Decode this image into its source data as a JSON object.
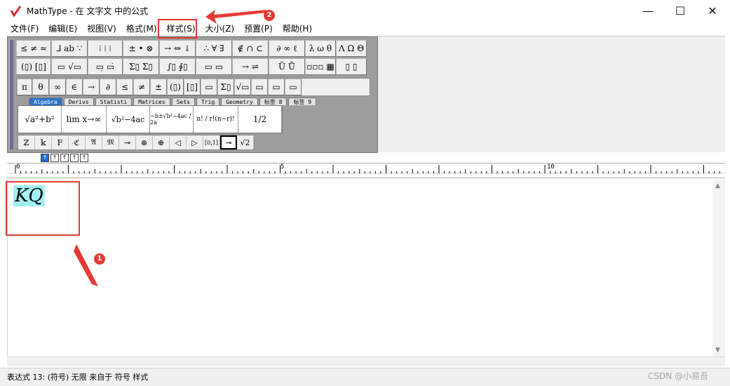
{
  "window": {
    "title": "MathType - 在 文字文 中的公式",
    "controls": {
      "minimize": "—",
      "maximize": "☐",
      "close": "✕"
    }
  },
  "menu": [
    {
      "label": "文件(F)"
    },
    {
      "label": "编辑(E)"
    },
    {
      "label": "视图(V)"
    },
    {
      "label": "格式(M)"
    },
    {
      "label": "样式(S)"
    },
    {
      "label": "大小(Z)"
    },
    {
      "label": "预置(P)"
    },
    {
      "label": "帮助(H)"
    }
  ],
  "toolbar": {
    "row1": [
      "≤ ≠ ≈",
      "⅃ ab ∵",
      "⁞ ⁞ ⁞",
      "± • ⊗",
      "→ ⇔ ↓",
      "∴ ∀ ∃",
      "∉ ∩ ⊂",
      "∂ ∞ ℓ",
      "λ ω θ",
      "Λ Ω Θ"
    ],
    "row2": [
      "(▯) [▯]",
      "▭ √▭",
      "▭̣ ▭̇",
      "Σ▯ Σ▯",
      "∫▯ ∮▯",
      "▭ ▭",
      "→ ⇌",
      "Ū Ů",
      "▫▫▫ ▦",
      "▯ ▯"
    ],
    "row3": [
      "π",
      "θ",
      "∞",
      "∈",
      "→",
      "∂",
      "≤",
      "≠",
      "±",
      "(▯)",
      "[▯]",
      "▭",
      "Σ▯",
      "√▭",
      "▭",
      "▭",
      "▭"
    ],
    "tabs": [
      "Algebra",
      "Derivs",
      "Statisti",
      "Matrices",
      "Sets",
      "Trig",
      "Geometry",
      "标签 8",
      "标签 9"
    ],
    "templates": [
      "√a²+b²",
      "lim x→∞",
      "√b²−4ac",
      "−b±√b²−4ac / 2a",
      "n! / r!(n−r)!",
      "1/2"
    ],
    "row5": [
      "ℤ",
      "𝕜",
      "F",
      "ℭ",
      "𝔄",
      "𝔐",
      "⊸",
      "⊗",
      "⊕",
      "◁",
      "▷",
      "[0,1]",
      "⊸",
      "√2"
    ]
  },
  "ruler": {
    "marks": [
      "0",
      "5",
      "10"
    ]
  },
  "document": {
    "equation": "KQ"
  },
  "status": {
    "text": "表达式 13: (符号) 无限 来自于 符号 样式",
    "watermark": "CSDN @小易吾"
  },
  "annotations": {
    "badge1": "1",
    "badge2": "2"
  },
  "colors": {
    "annotation": "#e53935",
    "selection": "#9ff1f4",
    "active_tab": "#2b72c9"
  }
}
